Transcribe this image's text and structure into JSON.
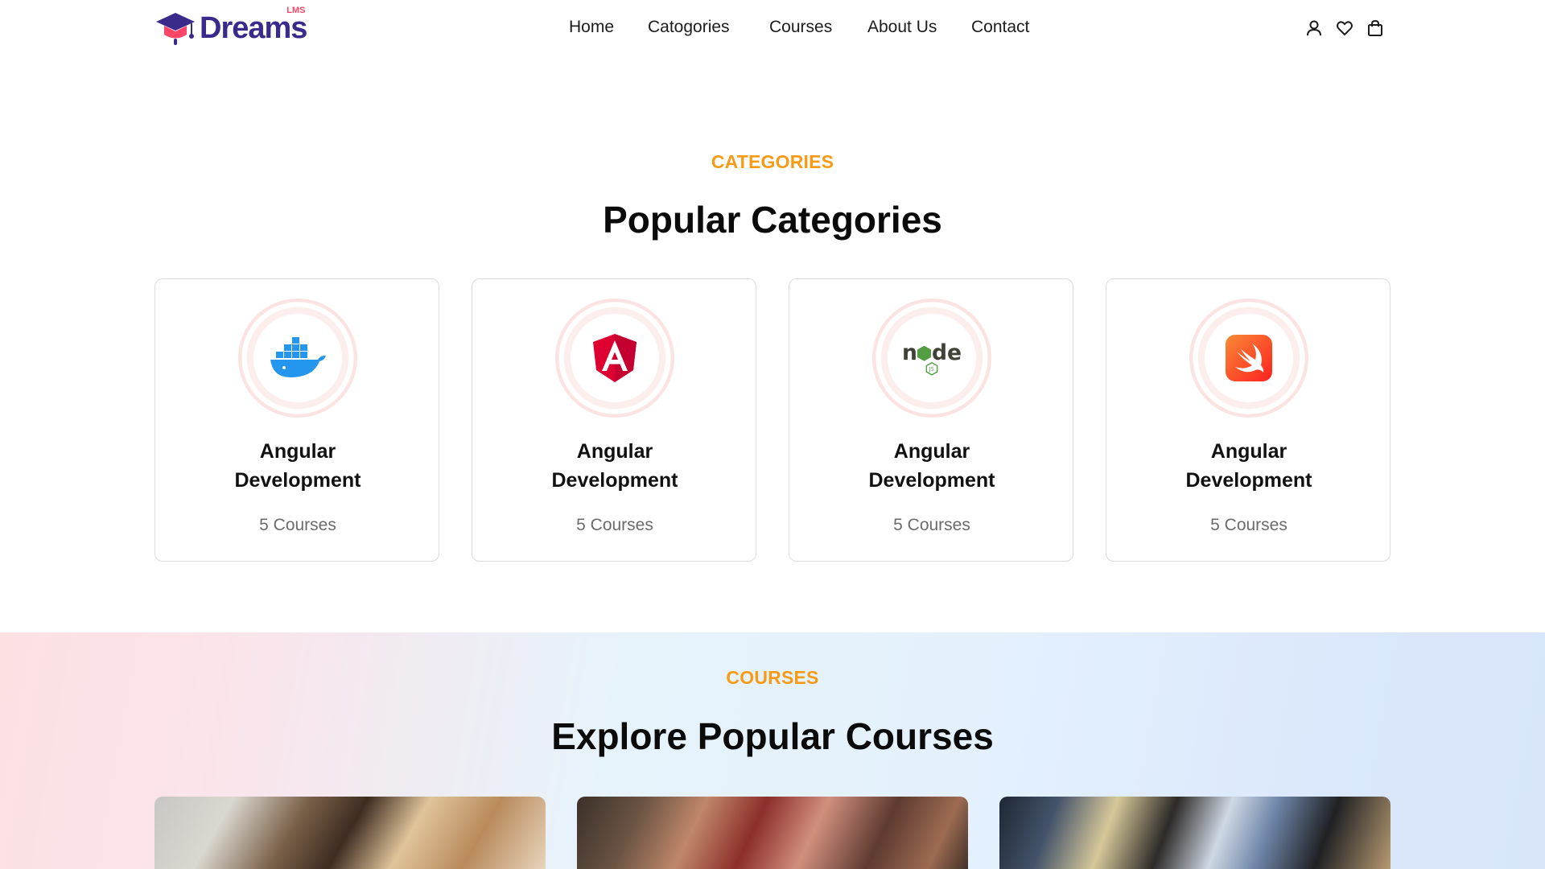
{
  "header": {
    "logo_text": "Dreams",
    "logo_sup": "LMS",
    "nav": [
      "Home",
      "Catogories",
      "Courses",
      "About Us",
      "Contact"
    ],
    "icons": [
      "user-icon",
      "heart-icon",
      "bag-icon"
    ]
  },
  "categories": {
    "eyebrow": "CATEGORIES",
    "title": "Popular Categories",
    "cards": [
      {
        "icon": "docker-icon",
        "title_line1": "Angular",
        "title_line2": "Development",
        "count": "5 Courses"
      },
      {
        "icon": "angular-icon",
        "title_line1": "Angular",
        "title_line2": "Development",
        "count": "5 Courses"
      },
      {
        "icon": "node-icon",
        "title_line1": "Angular",
        "title_line2": "Development",
        "count": "5 Courses"
      },
      {
        "icon": "swift-icon",
        "title_line1": "Angular",
        "title_line2": "Development",
        "count": "5 Courses"
      }
    ]
  },
  "courses": {
    "eyebrow": "COURSES",
    "title": "Explore Popular Courses"
  },
  "colors": {
    "accent": "#f79a16",
    "brand": "#3a2a8c",
    "brand_secondary": "#ff4667"
  }
}
